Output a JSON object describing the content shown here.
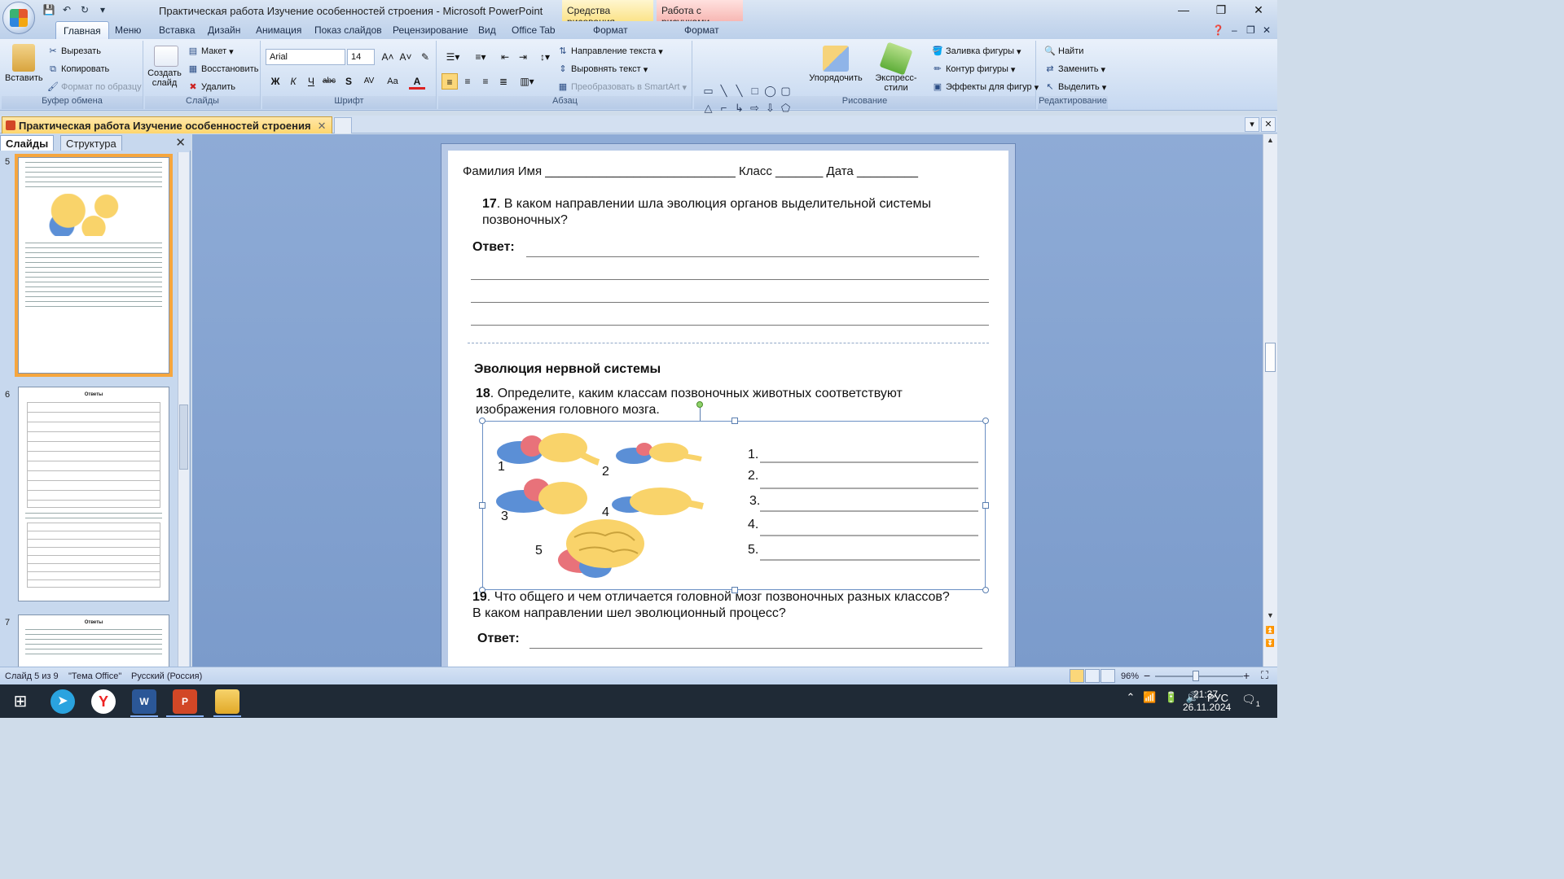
{
  "titlebar": {
    "title": "Практическая работа Изучение особенностей строения - Microsoft PowerPoint",
    "ctx_drawing": "Средства рисования",
    "ctx_picture": "Работа с рисунками",
    "minimize": "—",
    "restore": "❐",
    "close": "✕"
  },
  "ribbon_tabs": [
    "Главная",
    "Меню",
    "Вставка",
    "Дизайн",
    "Анимация",
    "Показ слайдов",
    "Рецензирование",
    "Вид",
    "Office Tab",
    "Формат",
    "Формат"
  ],
  "clipboard": {
    "paste": "Вставить",
    "cut": "Вырезать",
    "copy": "Копировать",
    "format_painter": "Формат по образцу",
    "label": "Буфер обмена"
  },
  "slides_group": {
    "new_slide": "Создать слайд",
    "layout": "Макет",
    "reset": "Восстановить",
    "delete": "Удалить",
    "label": "Слайды"
  },
  "font_group": {
    "font": "Arial",
    "size": "14",
    "label": "Шрифт",
    "bold": "Ж",
    "italic": "К",
    "underline": "Ч",
    "strike": "abc",
    "shadow": "S",
    "spacing": "AV",
    "case": "Aa",
    "color": "A"
  },
  "paragraph_group": {
    "text_direction": "Направление текста",
    "align_text": "Выровнять текст",
    "smartart": "Преобразовать в SmartArt",
    "label": "Абзац"
  },
  "drawing_group": {
    "arrange": "Упорядочить",
    "quick_styles": "Экспресс-стили",
    "fill": "Заливка фигуры",
    "outline": "Контур фигуры",
    "effects": "Эффекты для фигур",
    "label": "Рисование"
  },
  "editing_group": {
    "find": "Найти",
    "replace": "Заменить",
    "select": "Выделить",
    "label": "Редактирование"
  },
  "doc_tab": {
    "name": "Практическая работа Изучение особенностей строения",
    "close": "✕"
  },
  "pane": {
    "slides_tab": "Слайды",
    "outline_tab": "Структура",
    "close": "✕",
    "slide_numbers": [
      "5",
      "6",
      "7"
    ],
    "thumb6_title": "Ответы",
    "thumb7_title": "Ответы"
  },
  "slide": {
    "header": "Фамилия Имя ____________________________     Класс _______   Дата _________",
    "q17_num": "17",
    "q17_line1": ". В каком направлении шла эволюция органов выделительной системы",
    "q17_line2": "позвоночных?",
    "answer_label": "Ответ:",
    "section_title": "Эволюция нервной системы",
    "q18_num": "18",
    "q18_line1": ". Определите, каким классам позвоночных животных  соответствуют",
    "q18_line2": "изображения головного мозга.",
    "brain_labels": [
      "1",
      "2",
      "3",
      "4",
      "5"
    ],
    "answer_list": [
      "1.",
      "2.",
      "3.",
      "4.",
      "5."
    ],
    "q19_num": "19",
    "q19_line1": ". Что общего и чем отличается головной мозг позвоночных разных классов?",
    "q19_line2": "В каком направлении шел эволюционный процесс?",
    "answer_label2": "Ответ:"
  },
  "status": {
    "slide": "Слайд 5 из 9",
    "theme": "\"Тема Office\"",
    "language": "Русский (Россия)",
    "zoom": "96%",
    "zoom_minus": "−",
    "zoom_plus": "+"
  },
  "taskbar": {
    "lang": "РУС",
    "time": "21:37",
    "date": "26.11.2024",
    "notifications": "1"
  },
  "colors": {
    "accent": "#f6a63e",
    "ribbon": "#d4e2f4",
    "brain_yellow": "#f9d36a",
    "brain_blue": "#5b8fd6",
    "brain_red": "#e8727a"
  }
}
